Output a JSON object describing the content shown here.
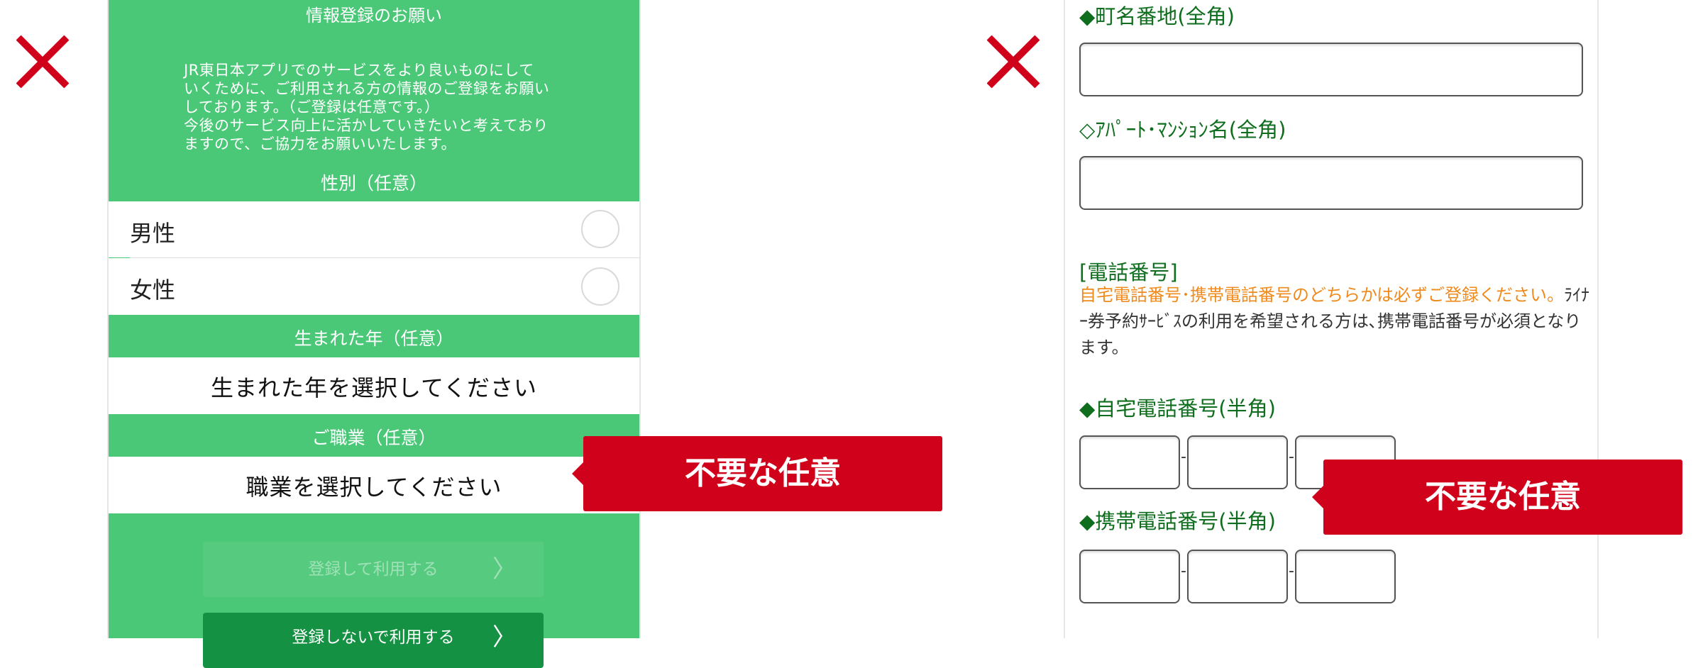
{
  "left_panel": {
    "heading": "情報登録のお願い",
    "intro_lines": [
      "JR東日本アプリでのサービスをより良いものにして",
      "いくために、ご利用される方の情報のご登録をお願い",
      "しております。（ご登録は任意です。）",
      "今後のサービス向上に活かしていきたいと考えており",
      "ますので、ご協力をお願いいたします。"
    ],
    "gender_header": "性別（任意）",
    "gender_options": [
      "男性",
      "女性"
    ],
    "birth_year_header": "生まれた年（任意）",
    "birth_year_select": "生まれた年を選択してください",
    "occupation_header": "ご職業（任意）",
    "occupation_select": "職業を選択してください",
    "register_button": "登録して利用する",
    "skip_button": "登録しないで利用する",
    "chevron": "〉"
  },
  "right_panel": {
    "town_label": "◆町名番地(全角)",
    "apartment_label": "◇ｱﾊﾟｰﾄ･ﾏﾝｼｮﾝ名(全角)",
    "phone_section_title": "[電話番号]",
    "phone_note_orange": "自宅電話番号･携帯電話番号のどちらかは必ずご登録ください。",
    "phone_note_rest": "ﾗｲﾅｰ券予約ｻｰﾋﾞｽの利用を希望される方は､携帯電話番号が必須となります。",
    "home_phone_label": "◆自宅電話番号(半角)",
    "mobile_phone_label": "◆携帯電話番号(半角)",
    "dash": "-"
  },
  "callouts": {
    "left": "不要な任意",
    "right": "不要な任意"
  },
  "colors": {
    "accent_green": "#4ac878",
    "dark_green": "#149142",
    "label_green": "#0f6e1e",
    "callout_red": "#d0021b",
    "note_orange": "#f08a1c"
  },
  "icons": {
    "cross": "x-mark-icon"
  }
}
